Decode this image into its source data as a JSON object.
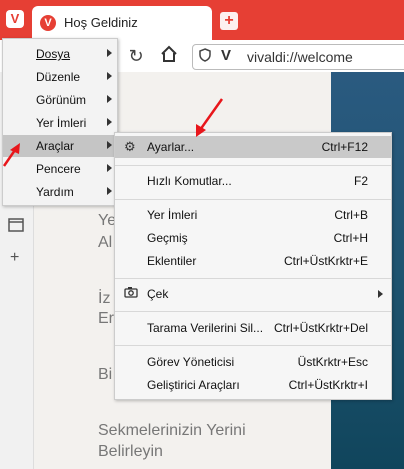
{
  "tab": {
    "title": "Hoş Geldiniz"
  },
  "address": {
    "url": "vivaldi://welcome"
  },
  "icons": {
    "vivaldi_menu": "vivaldi-menu-icon",
    "new_tab": "plus-icon",
    "reload": "reload-icon",
    "home": "home-icon",
    "shield": "shield-icon",
    "site": "vivaldi-site-icon",
    "panel_tabs": "window-icon",
    "panel_add": "plus-icon"
  },
  "main_menu": [
    {
      "label": "Dosya"
    },
    {
      "label": "Düzenle"
    },
    {
      "label": "Görünüm"
    },
    {
      "label": "Yer İmleri"
    },
    {
      "label": "Araçlar"
    },
    {
      "label": "Pencere"
    },
    {
      "label": "Yardım"
    }
  ],
  "submenu": [
    {
      "label": "Ayarlar...",
      "shortcut": "Ctrl+F12",
      "icon": "gear-icon"
    },
    {
      "label": "Hızlı Komutlar...",
      "shortcut": "F2"
    },
    {
      "label": "Yer İmleri",
      "shortcut": "Ctrl+B"
    },
    {
      "label": "Geçmiş",
      "shortcut": "Ctrl+H"
    },
    {
      "label": "Eklentiler",
      "shortcut": "Ctrl+ÜstKrktr+E"
    },
    {
      "label": "Çek",
      "icon": "camera-icon"
    },
    {
      "label": "Tarama Verilerini Sil...",
      "shortcut": "Ctrl+ÜstKrktr+Del"
    },
    {
      "label": "Görev Yöneticisi",
      "shortcut": "ÜstKrktr+Esc"
    },
    {
      "label": "Geliştirici Araçları",
      "shortcut": "Ctrl+ÜstKrktr+I"
    }
  ],
  "page_fragments": {
    "f1a": "Ye",
    "f1b": "Al",
    "f2a": "İz",
    "f2b": "Er",
    "f3": "Bi",
    "f4a": "Sekmelerinizin Yerini",
    "f4b": "Belirleyin"
  },
  "colors": {
    "titlebar": "#e63f34",
    "annotation_arrow": "#e8161b"
  }
}
